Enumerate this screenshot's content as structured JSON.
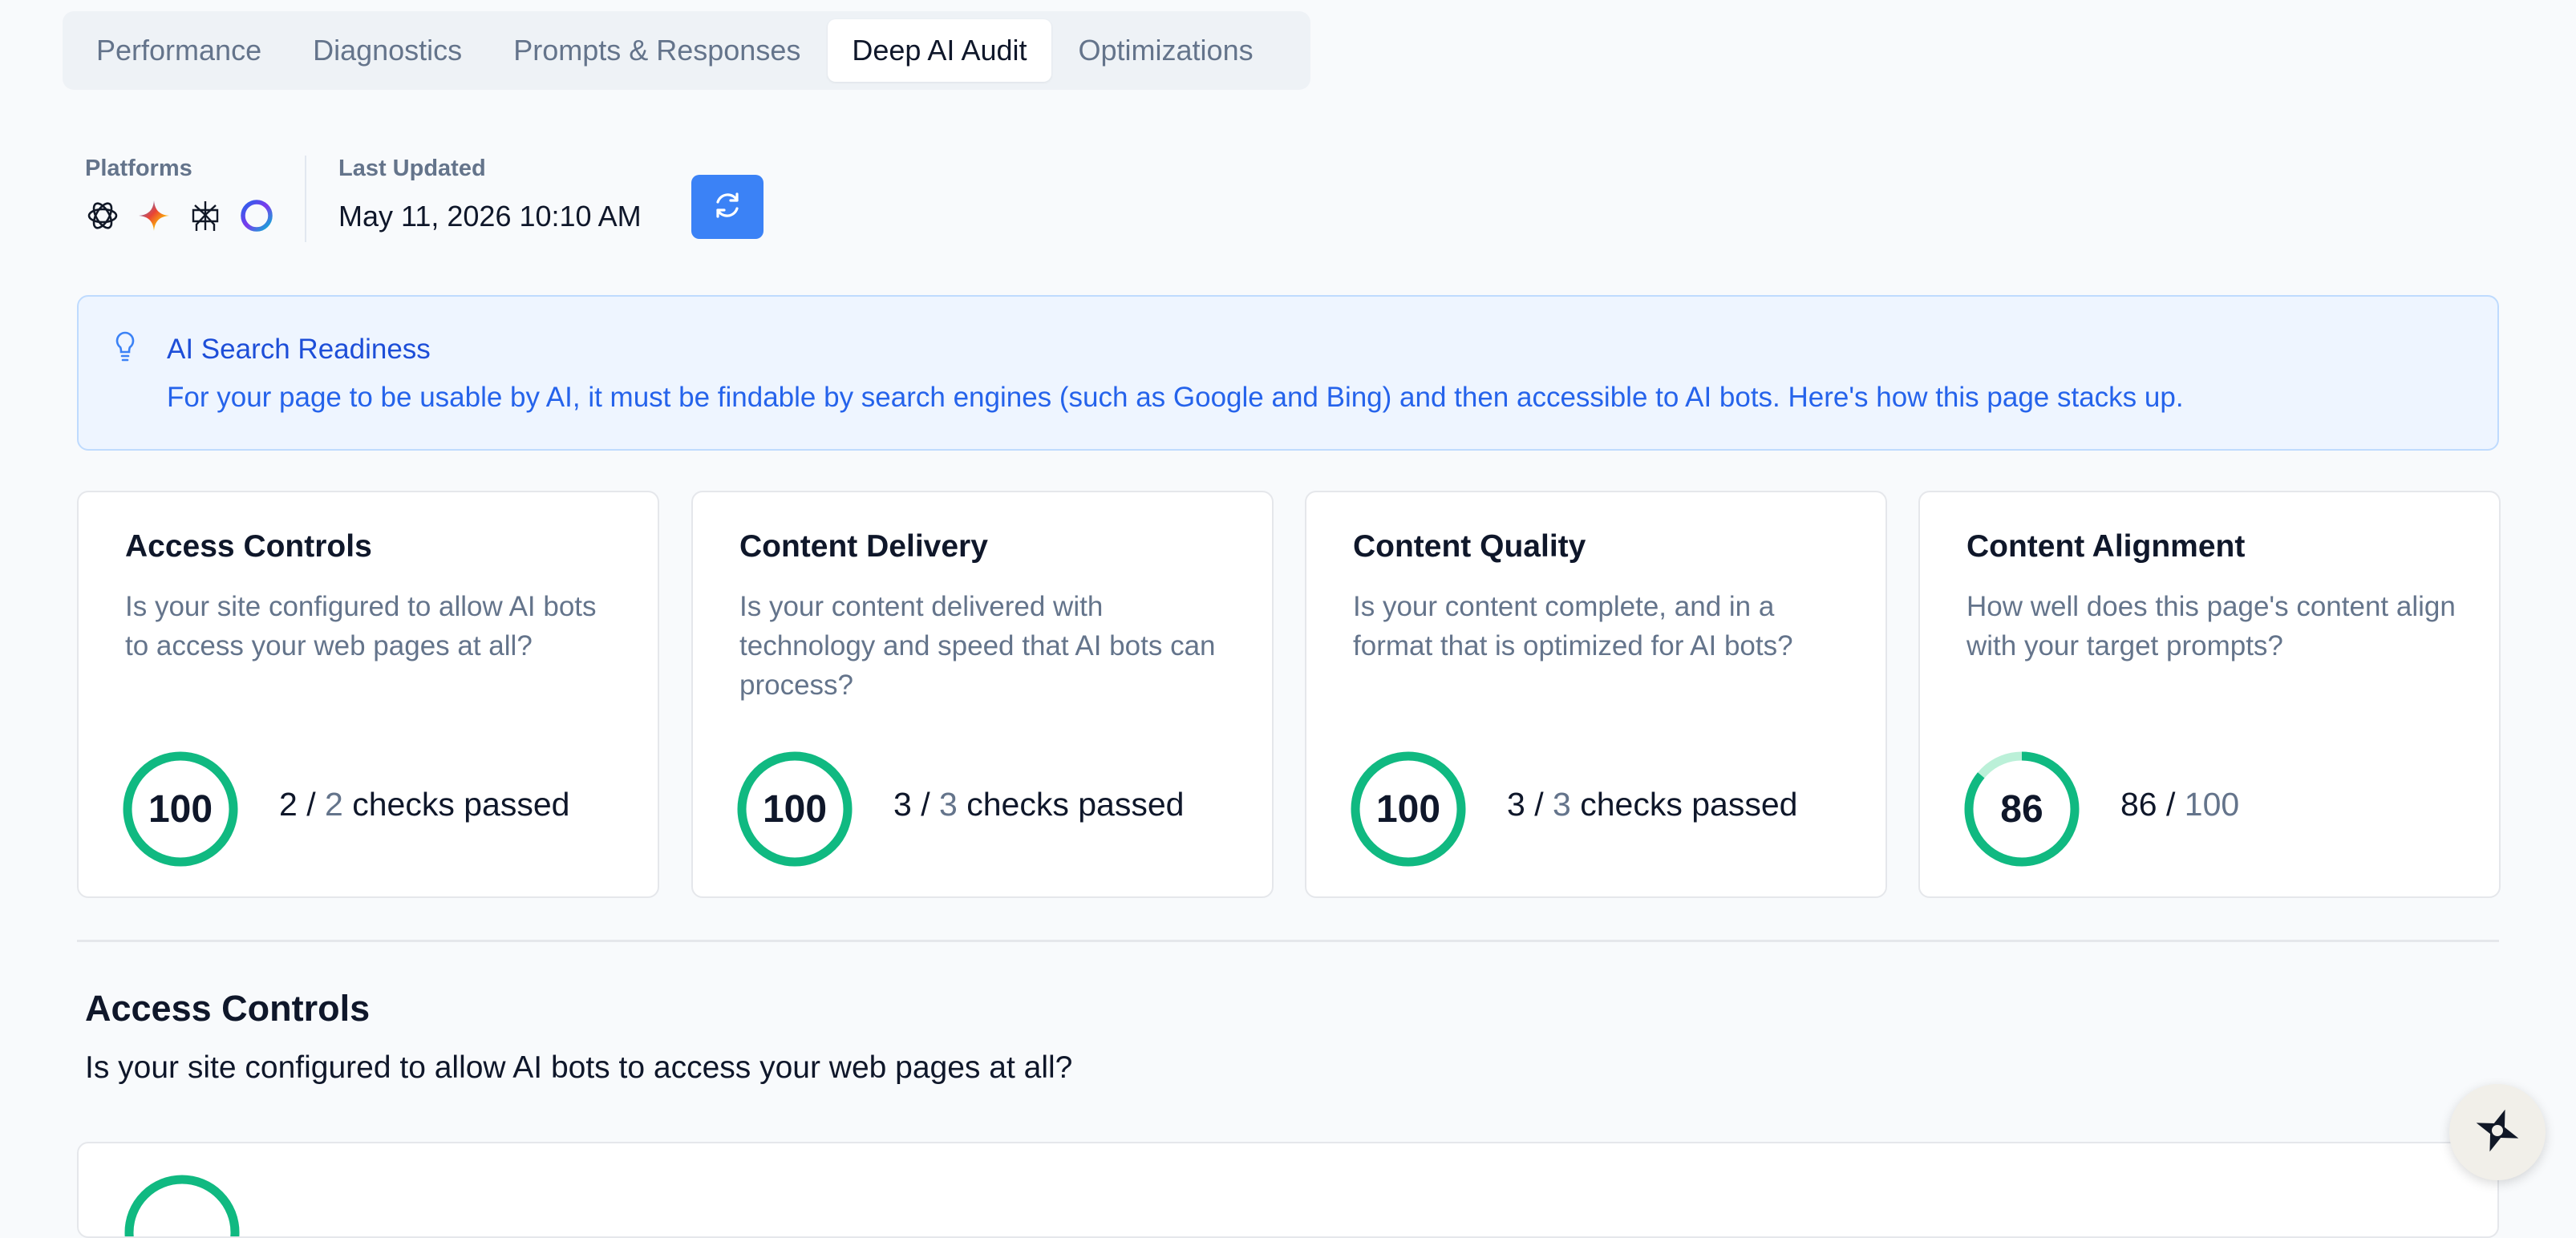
{
  "tabs": [
    {
      "label": "Performance"
    },
    {
      "label": "Diagnostics"
    },
    {
      "label": "Prompts & Responses"
    },
    {
      "label": "Deep AI Audit",
      "active": true
    },
    {
      "label": "Optimizations"
    }
  ],
  "meta": {
    "platforms_label": "Platforms",
    "platform_icons": [
      "chatgpt-icon",
      "gemini-icon",
      "perplexity-icon",
      "copilot-icon"
    ],
    "last_updated_label": "Last Updated",
    "last_updated_value": "May 11, 2026 10:10 AM"
  },
  "banner": {
    "title": "AI Search Readiness",
    "text": "For your page to be usable by AI, it must be findable by search engines (such as Google and Bing) and then accessible to AI bots. Here's how this page stacks up."
  },
  "cards": [
    {
      "title": "Access Controls",
      "description": "Is your site configured to allow AI bots to access your web pages at all?",
      "score": "100",
      "score_fraction": 1.0,
      "passed": "2",
      "total": "2",
      "suffix": "checks passed"
    },
    {
      "title": "Content Delivery",
      "description": "Is your content delivered with technology and speed that AI bots can process?",
      "score": "100",
      "score_fraction": 1.0,
      "passed": "3",
      "total": "3",
      "suffix": "checks passed"
    },
    {
      "title": "Content Quality",
      "description": "Is your content complete, and in a format that is optimized for AI bots?",
      "score": "100",
      "score_fraction": 1.0,
      "passed": "3",
      "total": "3",
      "suffix": "checks passed"
    },
    {
      "title": "Content Alignment",
      "description": "How well does this page's content align with your target prompts?",
      "score": "86",
      "score_fraction": 0.86,
      "passed": "86",
      "total": "100",
      "suffix": ""
    }
  ],
  "section": {
    "title": "Access Controls",
    "subtitle": "Is your site configured to allow AI bots to access your web pages at all?"
  },
  "colors": {
    "accent": "#3b82f6",
    "score_ring": "#10b981",
    "score_ring_track": "#bbf0d8",
    "banner_text": "#2563eb"
  }
}
